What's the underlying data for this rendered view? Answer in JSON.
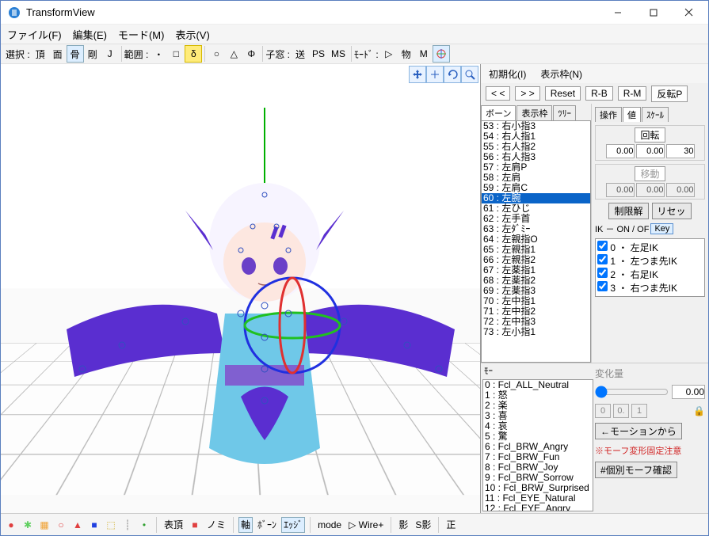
{
  "window": {
    "title": "TransformView"
  },
  "menu": {
    "file": "ファイル(F)",
    "edit": "編集(E)",
    "mode": "モード(M)",
    "view": "表示(V)"
  },
  "toolbar": {
    "select_lbl": "選択 : ",
    "vertex": "頂",
    "face": "面",
    "bone": "骨",
    "rigid": "剛",
    "joint": "J",
    "range_lbl": "範囲 : ",
    "dot": "・",
    "box": "□",
    "sigma": "δ",
    "circle": "○",
    "tri": "△",
    "phi": "Φ",
    "subwin_lbl": "子窓 : ",
    "send": "送",
    "ps": "PS",
    "ms": "MS",
    "mode_lbl": "ﾓｰﾄﾞ : ",
    "play": "▷",
    "phys": "物",
    "m": "M"
  },
  "side": {
    "menu_init": "初期化(I)",
    "menu_frame": "表示枠(N)",
    "prev": "< <",
    "next": "> >",
    "reset": "Reset",
    "rb": "R-B",
    "rm": "R-M",
    "flip": "反転P",
    "tabs": {
      "bone": "ボーン",
      "frame": "表示枠",
      "tree": "ﾂﾘｰ"
    },
    "rtabs": {
      "op": "操作",
      "val": "値",
      "scale": "ｽｹｰﾙ"
    },
    "rot_lbl": "回転",
    "mov_lbl": "移動",
    "rot_vals": [
      "0.00",
      "0.00",
      "30"
    ],
    "mov_vals": [
      "0.00",
      "0.00",
      "0.00"
    ],
    "limit_off": "制限解",
    "reset_btn": "リセッ",
    "ik_lbl": "IK － ON / OF",
    "key": "Key",
    "ik_items": [
      "0 ・ 左足IK",
      "1 ・ 左つま先IK",
      "2 ・ 右足IK",
      "3 ・ 右つま先IK"
    ],
    "bones": [
      "53 : 右小指3",
      "54 : 右人指1",
      "55 : 右人指2",
      "56 : 右人指3",
      "57 : 左肩P",
      "58 : 左肩",
      "59 : 左肩C",
      "60 : 左腕",
      "61 : 左ひじ",
      "62 : 左手首",
      "63 : 左ﾀﾞﾐｰ",
      "64 : 左親指O",
      "65 : 左親指1",
      "66 : 左親指2",
      "67 : 左薬指1",
      "68 : 左薬指2",
      "69 : 左薬指3",
      "70 : 左中指1",
      "71 : 左中指2",
      "72 : 左中指3",
      "73 : 左小指1"
    ],
    "bone_sel": 7,
    "morph_hdr": "ﾓｰ",
    "morphs": [
      "0 : Fcl_ALL_Neutral",
      "1 : 怒",
      "2 : 楽",
      "3 : 喜",
      "4 : 哀",
      "5 : 驚",
      "6 : Fcl_BRW_Angry",
      "7 : Fcl_BRW_Fun",
      "8 : Fcl_BRW_Joy",
      "9 : Fcl_BRW_Sorrow",
      "10 : Fcl_BRW_Surprised",
      "11 : Fcl_EYE_Natural",
      "12 : Fcl_EYE_Angry"
    ],
    "change_lbl": "変化量",
    "change_val": "0.00",
    "opt0": "0",
    "opt1": "0.",
    "opt2": "1",
    "from_motion": "←モーションから",
    "fix_note": "※モーフ変形固定注意",
    "fix_btn": "#個別モーフ確認"
  },
  "status": {
    "surface": "表頂",
    "nomi": "ノミ",
    "axis": "軸",
    "bn": "ﾎﾞｰﾝ",
    "edge": "ｴｯｼﾞ",
    "mode": "mode",
    "wire": "▷ Wire+",
    "shadow": "影",
    "sshadow": "S影",
    "norm": "正"
  }
}
